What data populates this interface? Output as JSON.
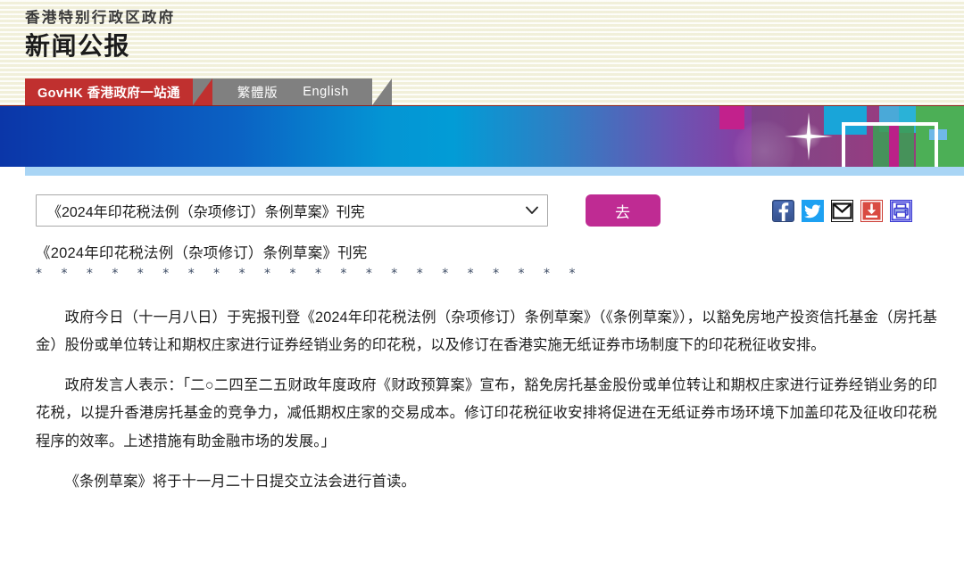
{
  "header": {
    "gov_name": "香港特别行政区政府",
    "bulletin": "新闻公报"
  },
  "nav": {
    "govhk_tab": "GovHK 香港政府一站通",
    "lang_traditional": "繁體版",
    "lang_english": "English"
  },
  "controls": {
    "select_value": "《2024年印花税法例（杂项修订）条例草案》刊宪",
    "go_label": "去",
    "icons": [
      {
        "name": "facebook-icon",
        "label": "Facebook",
        "color": "#3b5998"
      },
      {
        "name": "twitter-icon",
        "label": "Twitter",
        "color": "#1da1f2"
      },
      {
        "name": "email-icon",
        "label": "Email",
        "color": "#1a1a1a"
      },
      {
        "name": "download-icon",
        "label": "Download",
        "color": "#cc3333"
      },
      {
        "name": "print-icon",
        "label": "Print",
        "color": "#3333cc"
      }
    ]
  },
  "article": {
    "title": "《2024年印花税法例（杂项修订）条例草案》刊宪",
    "asterisks": "* * * * * * * * * * * * * * * * * * * * * *",
    "paragraphs": [
      "政府今日（十一月八日）于宪报刊登《2024年印花税法例（杂项修订）条例草案》（《条例草案》），以豁免房地产投资信托基金（房托基金）股份或单位转让和期权庄家进行证券经销业务的印花税，以及修订在香港实施无纸证券市场制度下的印花税征收安排。",
      "政府发言人表示：「二○二四至二五财政年度政府《财政预算案》宣布，豁免房托基金股份或单位转让和期权庄家进行证券经销业务的印花税，以提升香港房托基金的竞争力，减低期权庄家的交易成本。修订印花税征收安排将促进在无纸证券市场环境下加盖印花及征收印花税程序的效率。上述措施有助金融市场的发展。」",
      "《条例草案》将于十一月二十日提交立法会进行首读。"
    ]
  },
  "colors": {
    "govhk_red": "#c0302f",
    "lang_gray": "#808080",
    "header_cream": "#f7f6e6",
    "go_magenta": "#bf2b93",
    "banner_blue": "#0b36a8",
    "banner_cyan": "#029cd6",
    "banner_magenta": "#b5248a",
    "underline_blue": "#a9d5f5"
  }
}
